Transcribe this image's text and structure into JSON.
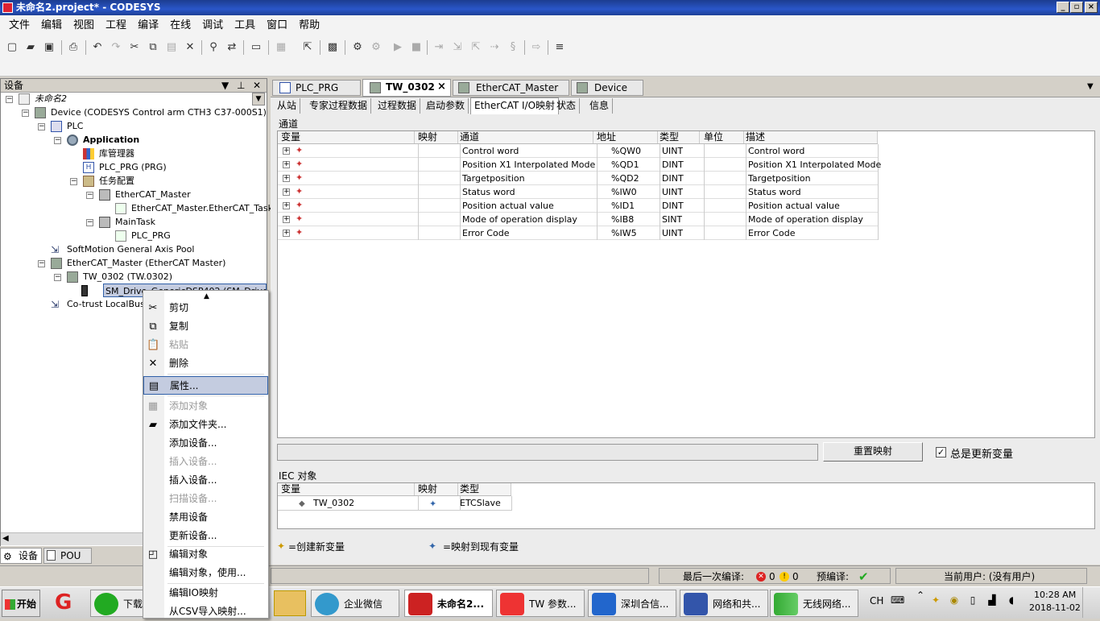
{
  "window": {
    "title": "未命名2.project* - CODESYS",
    "minimize": "_",
    "restore": "▫",
    "close": "×"
  },
  "menu": [
    "文件",
    "编辑",
    "视图",
    "工程",
    "编译",
    "在线",
    "调试",
    "工具",
    "窗口",
    "帮助"
  ],
  "devices_pane": {
    "title": "设备",
    "tree": [
      {
        "label": "未命名2",
        "italic": true
      },
      {
        "label": "Device (CODESYS Control arm CTH3 C37-000S1)"
      },
      {
        "label": "PLC"
      },
      {
        "label": "Application",
        "bold": true
      },
      {
        "label": "库管理器"
      },
      {
        "label": "PLC_PRG (PRG)"
      },
      {
        "label": "任务配置"
      },
      {
        "label": "EtherCAT_Master"
      },
      {
        "label": "EtherCAT_Master.EtherCAT_Task"
      },
      {
        "label": "MainTask"
      },
      {
        "label": "PLC_PRG"
      },
      {
        "label": "SoftMotion General Axis Pool"
      },
      {
        "label": "EtherCAT_Master (EtherCAT Master)"
      },
      {
        "label": "TW_0302 (TW.0302)"
      },
      {
        "label": "SM_Drive_GenericDSP402 (SM_Drive_Ger"
      },
      {
        "label": "Co-trust LocalBus"
      }
    ],
    "bottom_tabs": [
      "设备",
      "POU"
    ]
  },
  "editor": {
    "tabs": [
      "PLC_PRG",
      "TW_0302",
      "EtherCAT_Master",
      "Device"
    ],
    "active_tab": "TW_0302",
    "tab_close": "×",
    "sub_tabs": [
      "从站",
      "专家过程数据",
      "过程数据",
      "启动参数",
      "EtherCAT I/O映射",
      "状态",
      "信息"
    ],
    "active_sub_tab": "EtherCAT I/O映射",
    "channels_label": "通道",
    "columns": [
      "变量",
      "映射",
      "通道",
      "地址",
      "类型",
      "单位",
      "描述"
    ],
    "rows": [
      {
        "channel": "Control word",
        "address": "%QW0",
        "type": "UINT",
        "desc": "Control word"
      },
      {
        "channel": "Position X1 Interpolated Mode",
        "address": "%QD1",
        "type": "DINT",
        "desc": "Position X1 Interpolated Mode"
      },
      {
        "channel": "Targetposition",
        "address": "%QD2",
        "type": "DINT",
        "desc": "Targetposition"
      },
      {
        "channel": "Status word",
        "address": "%IW0",
        "type": "UINT",
        "desc": "Status word"
      },
      {
        "channel": "Position actual value",
        "address": "%ID1",
        "type": "DINT",
        "desc": "Position actual value"
      },
      {
        "channel": "Mode of operation display",
        "address": "%IB8",
        "type": "SINT",
        "desc": "Mode of operation display"
      },
      {
        "channel": "Error Code",
        "address": "%IW5",
        "type": "UINT",
        "desc": "Error Code"
      }
    ],
    "reset_mapping": "重置映射",
    "always_update": "总是更新变量",
    "iec_label": "IEC 对象",
    "iec_columns": [
      "变量",
      "映射",
      "类型"
    ],
    "iec_row": {
      "var": "TW_0302",
      "type": "ETCSlave"
    },
    "legend_new": "=创建新变量",
    "legend_existing": "=映射到现有变量"
  },
  "context_menu": [
    {
      "label": "剪切",
      "icon": "cut-icon",
      "glyph": "✂",
      "disabled": false
    },
    {
      "label": "复制",
      "icon": "copy-icon",
      "glyph": "⧉",
      "disabled": false
    },
    {
      "label": "粘贴",
      "icon": "paste-icon",
      "glyph": "📋",
      "disabled": true
    },
    {
      "label": "删除",
      "icon": "delete-icon",
      "glyph": "✕",
      "disabled": false
    },
    {
      "label": "属性...",
      "icon": "properties-icon",
      "glyph": "▤",
      "disabled": false,
      "selected": true
    },
    {
      "label": "添加对象",
      "icon": "add-object-icon",
      "glyph": "▦",
      "disabled": true
    },
    {
      "label": "添加文件夹...",
      "icon": "folder-icon",
      "glyph": "▰",
      "disabled": false
    },
    {
      "label": "添加设备...",
      "icon": "",
      "glyph": "",
      "disabled": false
    },
    {
      "label": "插入设备...",
      "icon": "",
      "glyph": "",
      "disabled": true
    },
    {
      "label": "插入设备...",
      "icon": "",
      "glyph": "",
      "disabled": false
    },
    {
      "label": "扫描设备...",
      "icon": "",
      "glyph": "",
      "disabled": true
    },
    {
      "label": "禁用设备",
      "icon": "",
      "glyph": "",
      "disabled": false
    },
    {
      "label": "更新设备...",
      "icon": "",
      "glyph": "",
      "disabled": false
    },
    {
      "label": "编辑对象",
      "icon": "edit-object-icon",
      "glyph": "◰",
      "disabled": false
    },
    {
      "label": "编辑对象，使用...",
      "icon": "",
      "glyph": "",
      "disabled": false
    },
    {
      "label": "编辑IO映射",
      "icon": "",
      "glyph": "",
      "disabled": false
    },
    {
      "label": "从CSV导入映射...",
      "icon": "",
      "glyph": "",
      "disabled": false
    }
  ],
  "status_bar": {
    "last_compile": "最后一次编译:",
    "errors": "0",
    "warnings": "0",
    "precompile": "预编译:",
    "current_user": "当前用户: (没有用户)"
  },
  "taskbar": {
    "start": "开始",
    "items": [
      "下载箱",
      "企业微信",
      "未命名2...",
      "TW 参数...",
      "深圳合信...",
      "网络和共...",
      "无线网络..."
    ],
    "lang": "CH",
    "time": "10:28 AM",
    "date": "2018-11-02"
  },
  "colors": {
    "title": "#2a56c8",
    "selection": "#c4cce0",
    "selection_border": "#3060a8"
  }
}
